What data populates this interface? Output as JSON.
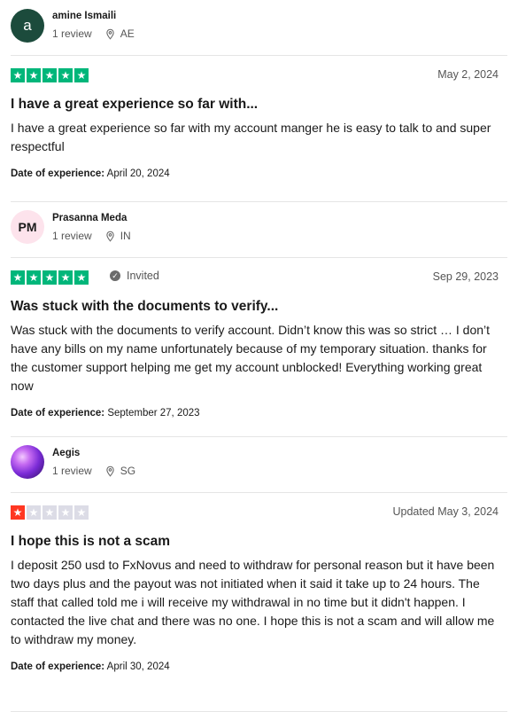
{
  "reviews": [
    {
      "avatar_text": "a",
      "name": "amine Ismaili",
      "review_count": "1 review",
      "country": "AE",
      "date": "May 2, 2024",
      "title": "I have a great experience so far with...",
      "body": "I have a great experience so far with my account manger he is easy to talk to and super respectful",
      "doe_label": "Date of experience:",
      "doe_value": "April 20, 2024"
    },
    {
      "avatar_text": "PM",
      "name": "Prasanna Meda",
      "review_count": "1 review",
      "country": "IN",
      "badge": "Invited",
      "date": "Sep 29, 2023",
      "title": "Was stuck with the documents to verify...",
      "body": "Was stuck with the documents to verify account. Didn’t know this was so strict … I don’t have any bills on my name unfortunately because of my temporary situation. thanks for the customer support helping me get my account unblocked! Everything working great now",
      "doe_label": "Date of experience:",
      "doe_value": "September 27, 2023"
    },
    {
      "name": "Aegis",
      "review_count": "1 review",
      "country": "SG",
      "date": "Updated May 3, 2024",
      "title": "I hope this is not a scam",
      "body": "I deposit 250 usd to FxNovus and need to withdraw for personal reason but it have been two days plus and the payout was not initiated when it said it take up to 24 hours. The staff that called told me i will receive my withdrawal in no time but it didn't happen. I contacted the live chat and there was no one. I hope this is not a scam and will allow me to withdraw my money.",
      "doe_label": "Date of experience:",
      "doe_value": "April 30, 2024"
    }
  ],
  "ratings": [
    5,
    5,
    1
  ],
  "colors": {
    "star_green": "#00b67a",
    "star_red": "#ff3722",
    "star_empty": "#dcdce6"
  }
}
